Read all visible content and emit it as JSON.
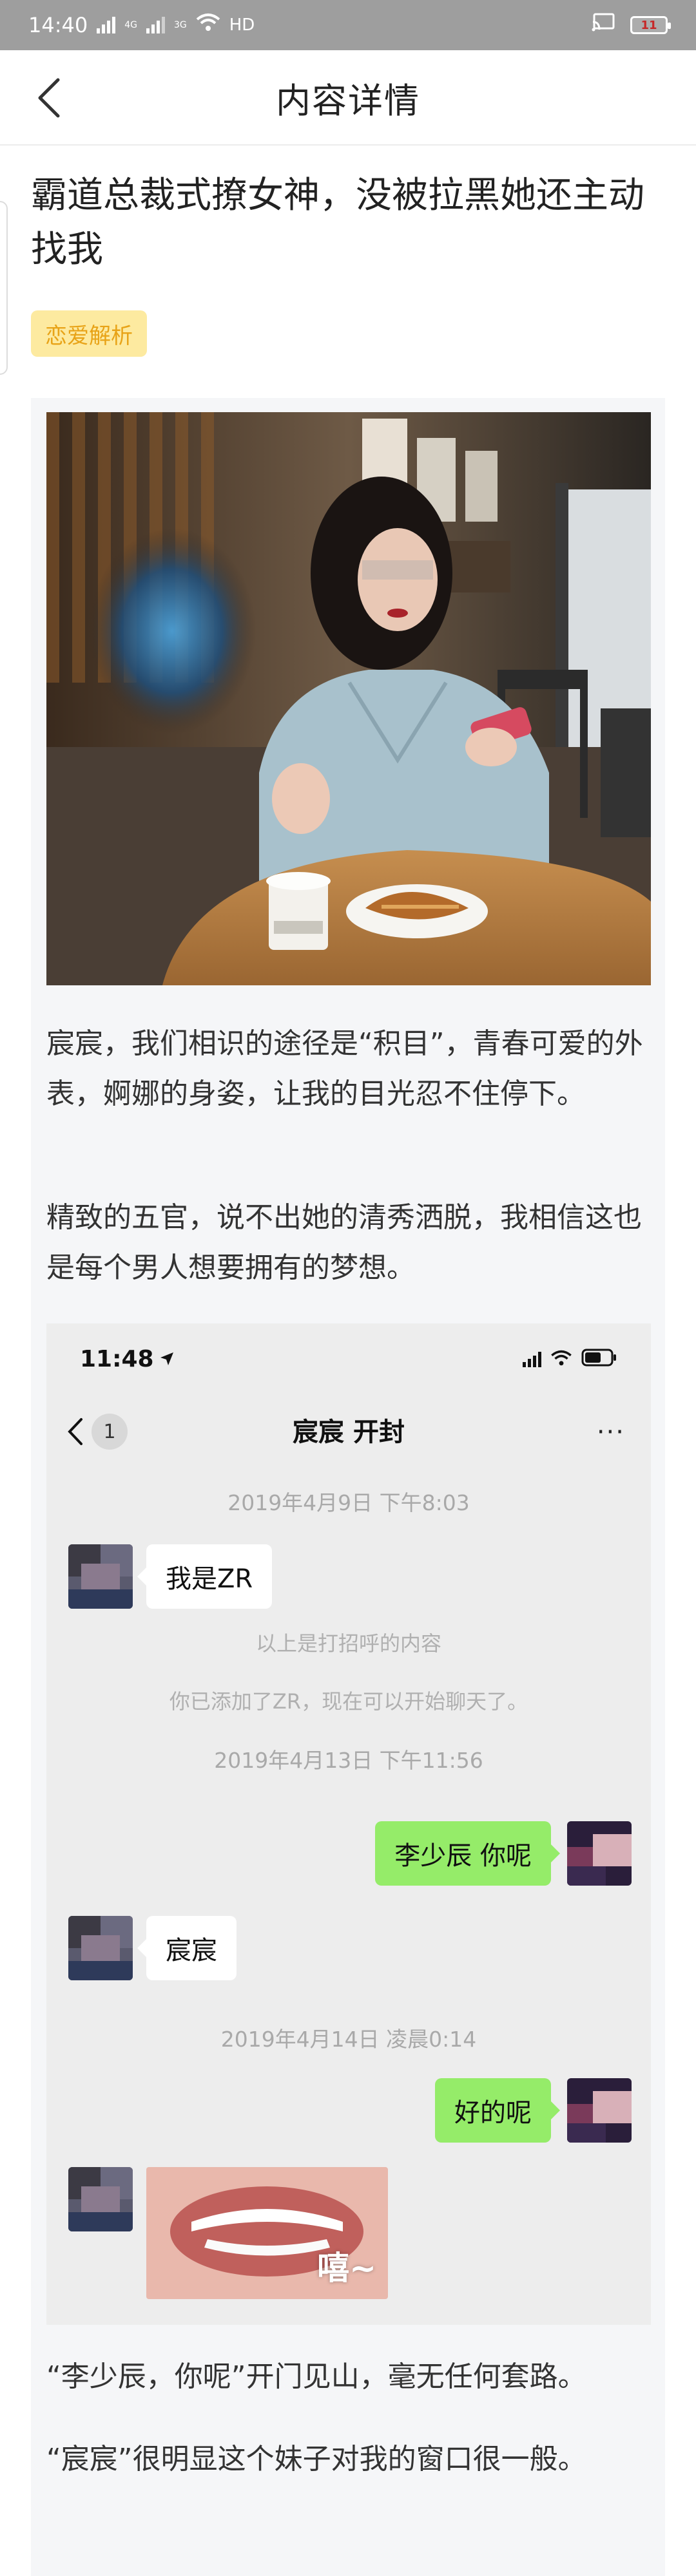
{
  "status_bar": {
    "time": "14:40",
    "network_1": "4G",
    "network_2": "3G",
    "network_3": "HD",
    "battery": "11"
  },
  "nav": {
    "title": "内容详情"
  },
  "article": {
    "title": "霸道总裁式撩女神，没被拉黑她还主动找我",
    "tag": "恋爱解析",
    "paragraphs": [
      "宸宸，我们相识的途径是“积目”，青春可爱的外表，婀娜的身姿，让我的目光忍不住停下。",
      "精致的五官，说不出她的清秀洒脱，我相信这也是每个男人想要拥有的梦想。",
      "“李少辰，你呢”开门见山，毫无任何套路。",
      "“宸宸”很明显这个妹子对我的窗口很一般。"
    ]
  },
  "chat": {
    "status_time": "11:48",
    "unread_count": "1",
    "title": "宸宸 开封",
    "more": "···",
    "timestamps": [
      "2019年4月9日 下午8:03",
      "2019年4月13日 下午11:56",
      "2019年4月14日 凌晨0:14"
    ],
    "system_notes": [
      "以上是打招呼的内容",
      "你已添加了ZR，现在可以开始聊天了。"
    ],
    "messages": {
      "m1": "我是ZR",
      "m2": "李少辰 你呢",
      "m3": "宸宸",
      "m4": "好的呢"
    },
    "sticker_text": "嘻~"
  },
  "colors": {
    "status_bar": "#9e9e9e",
    "tag_bg": "#fdeaa0",
    "tag_text": "#e8a317",
    "card_bg": "#f5f6f8",
    "chat_bg": "#ededed",
    "bubble_right": "#95ec69"
  }
}
